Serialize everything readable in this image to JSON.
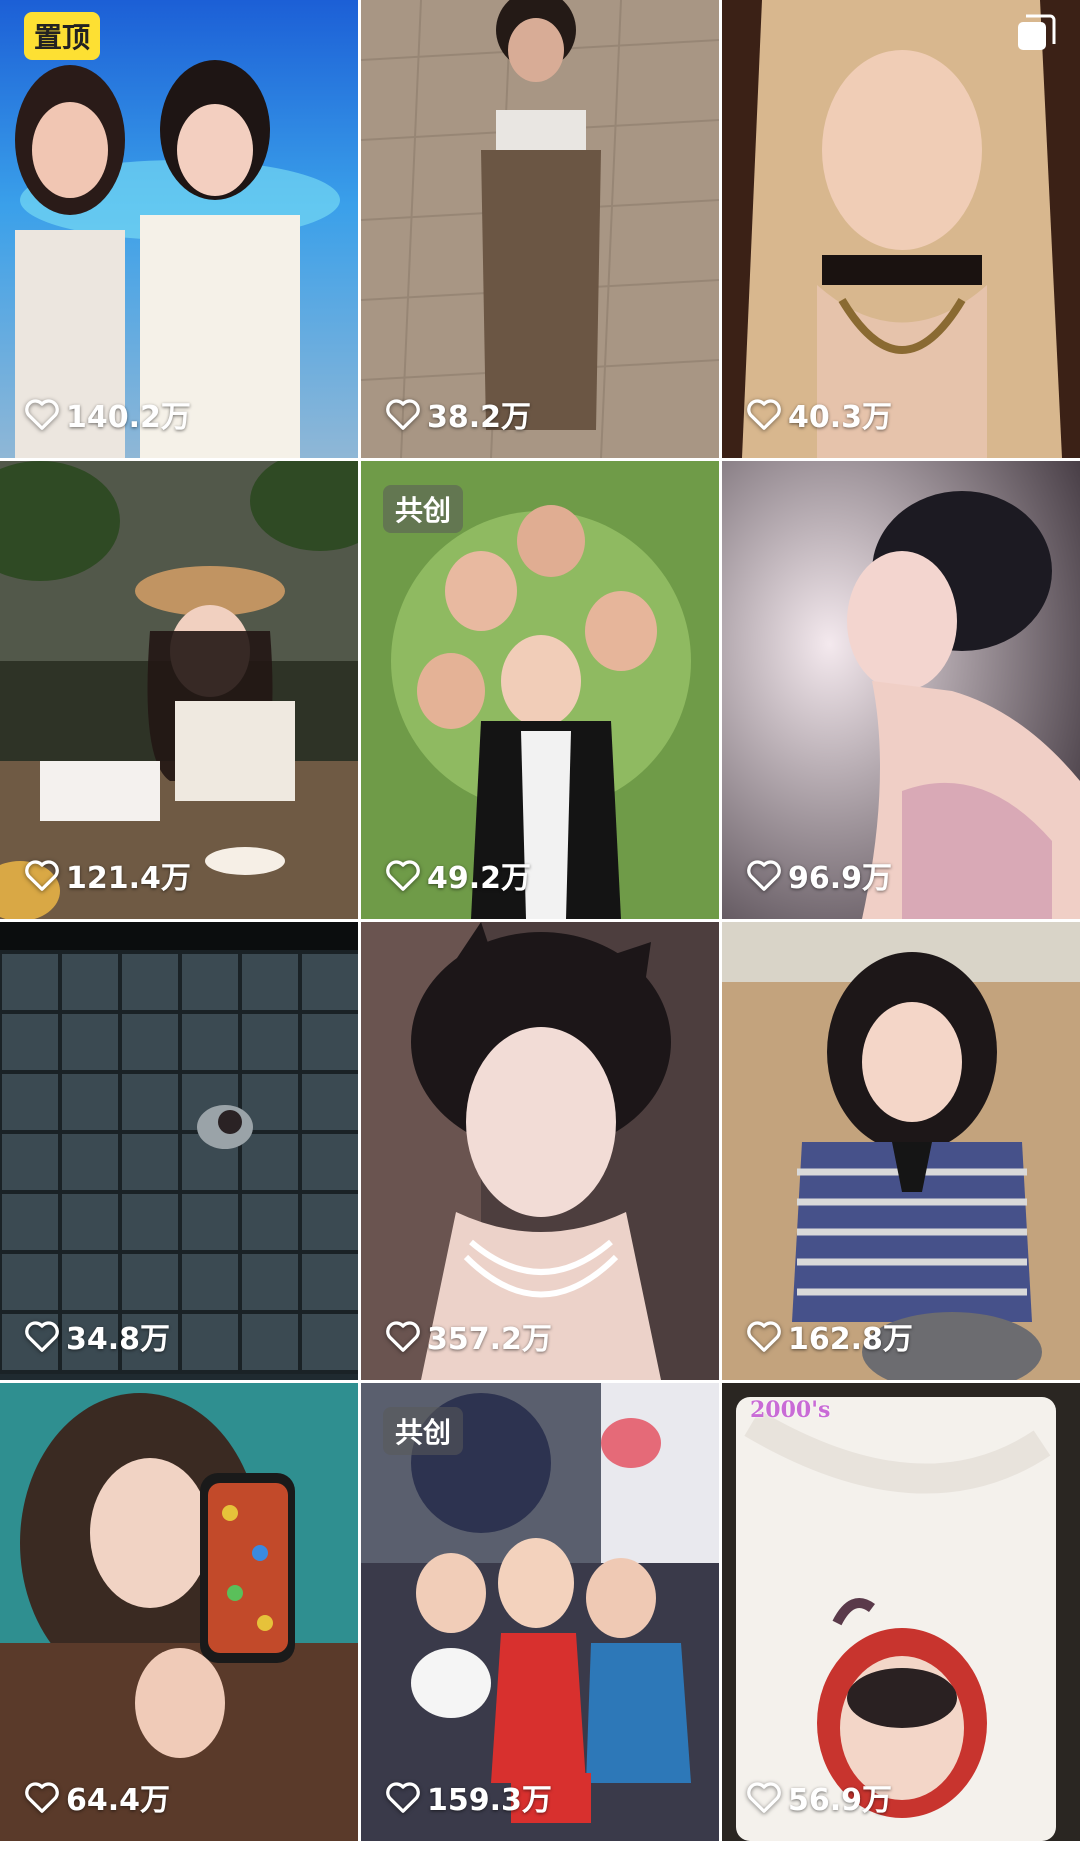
{
  "grid": {
    "tiles": [
      {
        "likes": "140.2万",
        "badge": "置顶"
      },
      {
        "likes": "38.2万"
      },
      {
        "likes": "40.3万",
        "icon": "multi-image-icon"
      },
      {
        "likes": "121.4万"
      },
      {
        "likes": "49.2万",
        "badge": "共创"
      },
      {
        "likes": "96.9万"
      },
      {
        "likes": "34.8万"
      },
      {
        "likes": "357.2万"
      },
      {
        "likes": "162.8万"
      },
      {
        "likes": "64.4万"
      },
      {
        "likes": "159.3万",
        "badge": "共创"
      },
      {
        "likes": "56.9万",
        "overlay_text": "2000's"
      }
    ]
  },
  "colors": {
    "pinned_badge": "#fde033",
    "like_text": "#ffffff",
    "background": "#ffffff"
  },
  "icons": {
    "like": "heart-outline-icon",
    "multi": "multi-image-icon"
  }
}
